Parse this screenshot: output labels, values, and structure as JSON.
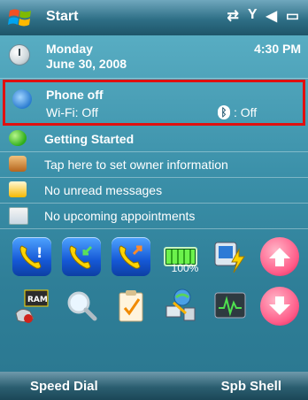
{
  "titlebar": {
    "title": "Start",
    "status_icons": [
      "data-connection-off-icon",
      "signal-off-icon",
      "speaker-muted-icon",
      "battery-icon"
    ]
  },
  "today": {
    "date_day": "Monday",
    "date_full": "June 30, 2008",
    "time": "4:30 PM",
    "phone": {
      "title": "Phone off",
      "wifi": "Wi-Fi: Off",
      "bluetooth": ": Off"
    },
    "items": [
      {
        "label": "Getting Started",
        "icon": "getting-started-icon"
      },
      {
        "label": "Tap here to set owner information",
        "icon": "owner-info-icon"
      },
      {
        "label": "No unread messages",
        "icon": "messages-icon"
      },
      {
        "label": "No upcoming appointments",
        "icon": "calendar-icon"
      }
    ]
  },
  "launcher": {
    "battery_level": "100%",
    "icons": [
      "missed-call-phone-icon",
      "incoming-call-phone-icon",
      "outgoing-call-phone-icon",
      "battery-icon",
      "power-settings-icon",
      "scroll-up-icon",
      "ram-memory-icon",
      "search-icon",
      "tasks-clipboard-icon",
      "sync-connect-icon",
      "task-manager-icon",
      "scroll-down-icon"
    ]
  },
  "softkeys": {
    "left": "Speed Dial",
    "right": "Spb Shell"
  },
  "colors": {
    "highlight_border": "#e01010",
    "background": "#3a8fa8"
  }
}
